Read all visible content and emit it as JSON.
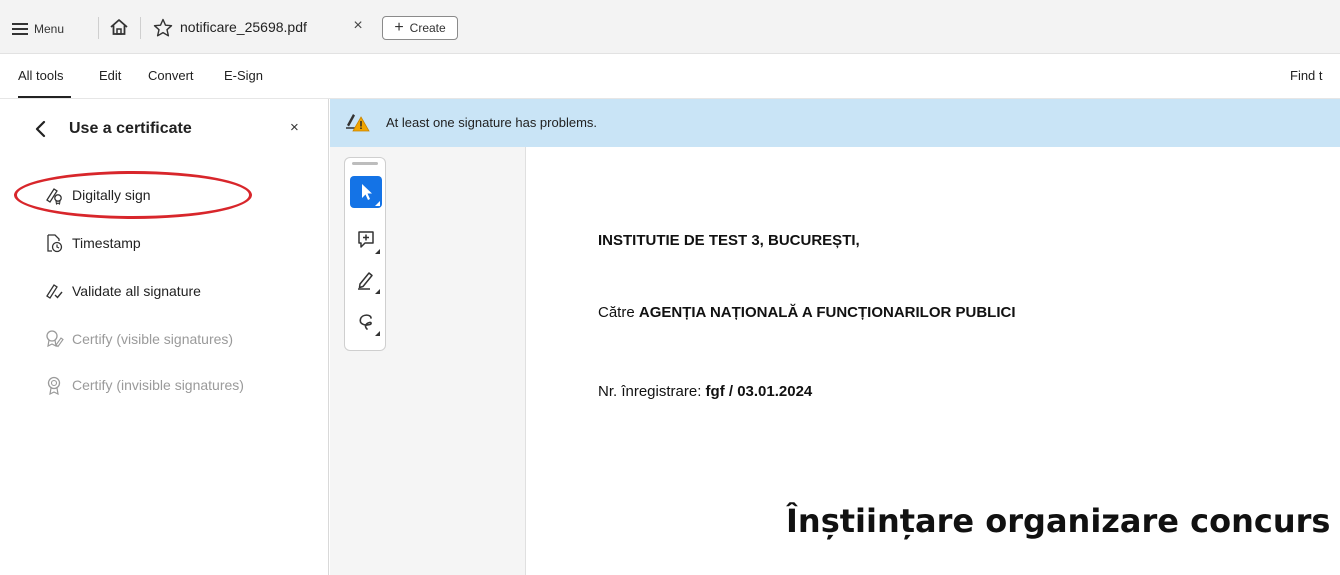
{
  "topbar": {
    "menu_label": "Menu",
    "home_icon": "home-icon",
    "star_icon": "star-icon",
    "file_name": "notificare_25698.pdf",
    "close_tab": "×",
    "create_label": "Create",
    "create_plus": "+"
  },
  "nav": {
    "items": [
      "All tools",
      "Edit",
      "Convert",
      "E-Sign"
    ],
    "find_text": "Find t"
  },
  "sidebar": {
    "back_icon": "chevron-left-icon",
    "title": "Use a certificate",
    "close": "×",
    "items": [
      {
        "label": "Digitally sign",
        "icon": "sign-pen-icon",
        "enabled": true
      },
      {
        "label": "Timestamp",
        "icon": "timestamp-icon",
        "enabled": true
      },
      {
        "label": "Validate all signature",
        "icon": "validate-signature-icon",
        "enabled": true
      },
      {
        "label": "Certify (visible signatures)",
        "icon": "certify-visible-icon",
        "enabled": false
      },
      {
        "label": "Certify (invisible signatures)",
        "icon": "certify-invisible-icon",
        "enabled": false
      }
    ],
    "highlight_color": "#d8262b"
  },
  "banner": {
    "text": "At least one signature has problems.",
    "icon": "signature-warning-icon",
    "bg_color": "#c9e4f6"
  },
  "tools": {
    "items": [
      {
        "name": "select-tool",
        "active": true
      },
      {
        "name": "add-comment-tool",
        "active": false
      },
      {
        "name": "draw-tool",
        "active": false
      },
      {
        "name": "lasso-tool",
        "active": false
      }
    ],
    "accent_color": "#1473e6"
  },
  "document": {
    "institution": "INSTITUTIE DE TEST 3, BUCUREȘTI,",
    "to_prefix": "Către",
    "to_name": "AGENȚIA NAȚIONALĂ A FUNCȚIONARILOR PUBLICI",
    "reg_prefix": "Nr. înregistrare:",
    "reg_value": "fgf / 03.01.2024",
    "heading": "Înștiințare organizare concurs"
  }
}
